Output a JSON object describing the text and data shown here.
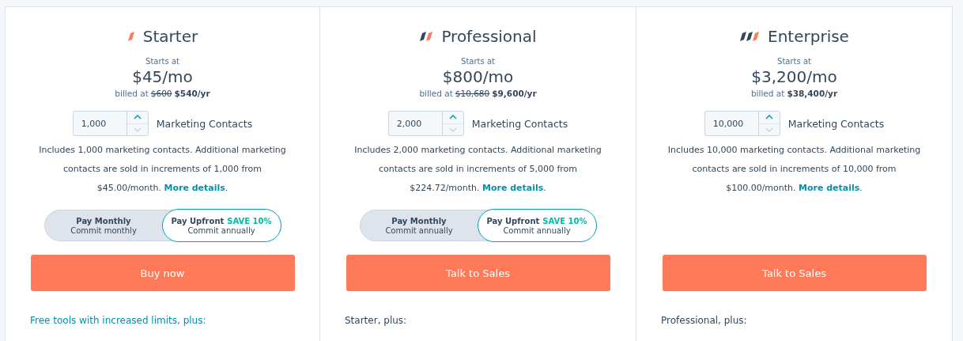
{
  "plans": [
    {
      "name": "Starter",
      "tier_icon": {
        "kind": "single"
      },
      "starts_label": "Starts at",
      "price": "$45/mo",
      "billing": {
        "prefix": "billed at",
        "old_price": "$600",
        "price": "$540/yr"
      },
      "contacts": {
        "value": "1,000",
        "label": "Marketing Contacts",
        "decrement_disabled": true
      },
      "description": {
        "text": "Includes 1,000 marketing contacts. Additional marketing contacts are sold in increments of 1,000 from $45.00/month.",
        "link": "More details",
        "after": "."
      },
      "payment_options": [
        {
          "label": "Pay Monthly",
          "sublabel": "Commit monthly",
          "selected": false
        },
        {
          "label": "Pay Upfront",
          "badge": "SAVE 10%",
          "sublabel": "Commit annually",
          "selected": true
        }
      ],
      "cta": "Buy now",
      "features_heading": "Free tools with increased limits, plus:",
      "features_heading_link": true
    },
    {
      "name": "Professional",
      "tier_icon": {
        "kind": "double"
      },
      "starts_label": "Starts at",
      "price": "$800/mo",
      "billing": {
        "prefix": "billed at",
        "old_price": "$10,680",
        "price": "$9,600/yr"
      },
      "contacts": {
        "value": "2,000",
        "label": "Marketing Contacts",
        "decrement_disabled": true
      },
      "description": {
        "text": "Includes 2,000 marketing contacts. Additional marketing contacts are sold in increments of 5,000 from $224.72/month.",
        "link": "More details",
        "after": "."
      },
      "payment_options": [
        {
          "label": "Pay Monthly",
          "sublabel": "Commit annually",
          "selected": false
        },
        {
          "label": "Pay Upfront",
          "badge": "SAVE 10%",
          "sublabel": "Commit annually",
          "selected": true
        }
      ],
      "cta": "Talk to Sales",
      "features_heading": "Starter, plus:",
      "features_heading_link": false
    },
    {
      "name": "Enterprise",
      "tier_icon": {
        "kind": "triple"
      },
      "starts_label": "Starts at",
      "price": "$3,200/mo",
      "billing": {
        "prefix": "billed at",
        "price": "$38,400/yr"
      },
      "contacts": {
        "value": "10,000",
        "label": "Marketing Contacts",
        "decrement_disabled": true
      },
      "description": {
        "text": "Includes 10,000 marketing contacts. Additional marketing contacts are sold in increments of 10,000 from $100.00/month.",
        "link": "More details",
        "after": "."
      },
      "cta": "Talk to Sales",
      "features_heading": "Professional, plus:",
      "features_heading_link": false
    }
  ]
}
